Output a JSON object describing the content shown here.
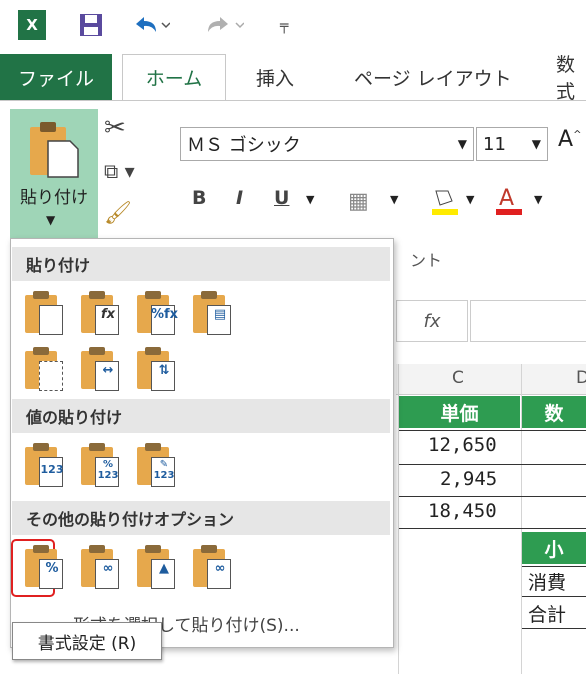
{
  "title_bar": {
    "app_icon": "excel-icon",
    "qat": {
      "save_icon": "save-icon",
      "undo_icon": "undo-icon",
      "redo_icon": "redo-icon",
      "customize_icon": "customize-qat-icon"
    }
  },
  "ribbon_tabs": {
    "file": "ファイル",
    "home": "ホーム",
    "insert": "挿入",
    "page_layout": "ページ レイアウト",
    "formulas": "数式"
  },
  "ribbon": {
    "paste_label": "貼り付け",
    "font_name": "ＭＳ ゴシック",
    "font_size": "11",
    "bold": "B",
    "italic": "I",
    "underline": "U",
    "font_group_fragment": "ント"
  },
  "formula_bar": {
    "fx": "fx"
  },
  "sheet": {
    "col_c": "C",
    "col_d": "D",
    "header_c": "単価",
    "header_d": "数",
    "values": [
      "12,650",
      "2,945",
      "18,450"
    ],
    "subtotal_label": "小",
    "row_labels": [
      "消費",
      "合計"
    ]
  },
  "paste_menu": {
    "section_paste": "貼り付け",
    "section_values": "値の貼り付け",
    "section_other": "その他の貼り付けオプション",
    "paste_special": "形式を選択して貼り付け(S)...",
    "tooltip": "書式設定 (R)"
  },
  "colors": {
    "excel_green": "#217346",
    "paste_highlight": "#9fd5b7",
    "selected_outline": "#e02020",
    "header_green": "#2e9c51"
  }
}
